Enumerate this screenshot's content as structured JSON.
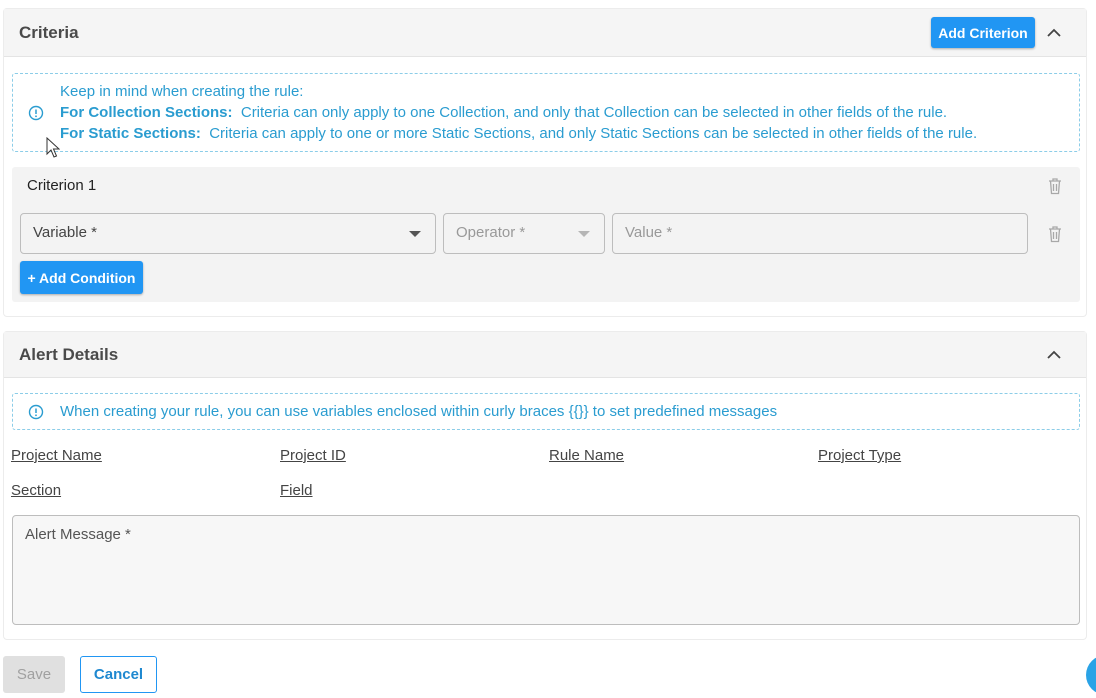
{
  "criteria": {
    "title": "Criteria",
    "add_criterion_label": "Add Criterion",
    "info": {
      "intro": "Keep in mind when creating the rule:",
      "collection_label": "For Collection Sections:",
      "collection_text": "Criteria can only apply to one Collection, and only that Collection can be selected in other fields of the rule.",
      "static_label": "For Static Sections:",
      "static_text": "Criteria can apply to one or more Static Sections, and only Static Sections can be selected in other fields of the rule."
    },
    "criterion": {
      "title": "Criterion 1",
      "variable_placeholder": "Variable *",
      "operator_placeholder": "Operator *",
      "value_placeholder": "Value *",
      "add_condition_label": "+ Add Condition"
    }
  },
  "alert": {
    "title": "Alert Details",
    "info_text": "When creating your rule, you can use variables enclosed within curly braces {{}} to set predefined messages",
    "variables": [
      "Project Name",
      "Project ID",
      "Rule Name",
      "Project Type",
      "Section",
      "Field"
    ],
    "message_placeholder": "Alert Message *"
  },
  "footer": {
    "save_label": "Save",
    "cancel_label": "Cancel"
  },
  "colors": {
    "primary": "#2196f3",
    "info": "#2a9cd0"
  }
}
